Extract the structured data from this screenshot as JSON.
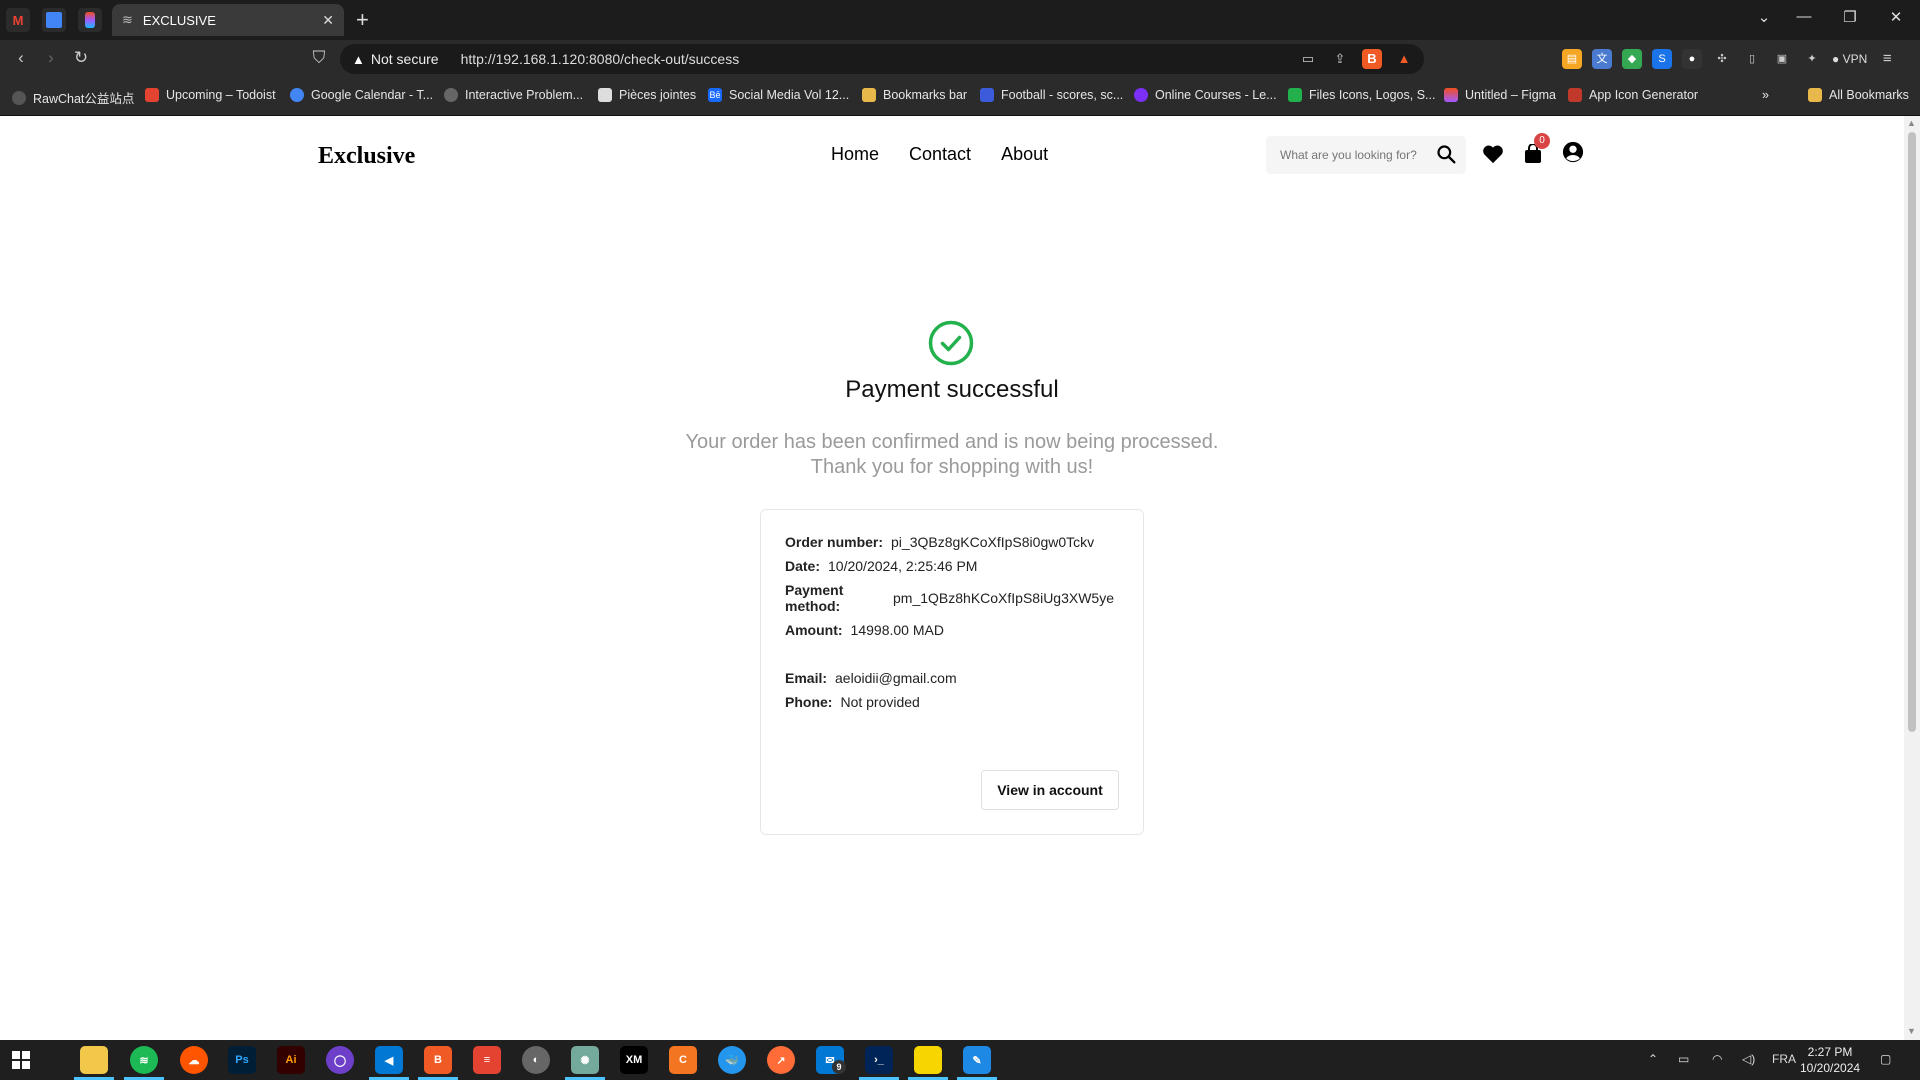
{
  "browser": {
    "tab_title": "EXCLUSIVE",
    "not_secure": "Not secure",
    "url": "http://192.168.1.120:8080/check-out/success",
    "vpn": "VPN",
    "bookmarks": [
      "RawChat公益站点",
      "Upcoming – Todoist",
      "Google Calendar - T...",
      "Interactive Problem...",
      "Pièces jointes",
      "Social Media Vol 12...",
      "Bookmarks bar",
      "Football - scores, sc...",
      "Online Courses - Le...",
      "Files Icons, Logos, S...",
      "Untitled – Figma",
      "App Icon Generator"
    ],
    "all_bookmarks": "All Bookmarks"
  },
  "header": {
    "brand": "Exclusive",
    "nav": [
      "Home",
      "Contact",
      "About"
    ],
    "search_placeholder": "What are you looking for?",
    "cart_count": "0"
  },
  "success": {
    "title": "Payment successful",
    "message_line1": "Your order has been confirmed and is now being processed.",
    "message_line2": "Thank you for shopping with us!"
  },
  "order": {
    "order_number_label": "Order number:",
    "order_number": "pi_3QBz8gKCoXfIpS8i0gw0Tckv",
    "date_label": "Date:",
    "date": "10/20/2024, 2:25:46 PM",
    "payment_method_label": "Payment method:",
    "payment_method": "pm_1QBz8hKCoXfIpS8iUg3XW5ye",
    "amount_label": "Amount:",
    "amount": "14998.00 MAD",
    "email_label": "Email:",
    "email": "aeloidii@gmail.com",
    "phone_label": "Phone:",
    "phone": "Not provided",
    "view_button": "View in account"
  },
  "taskbar": {
    "lang": "FRA",
    "time": "2:27 PM",
    "date": "10/20/2024",
    "badge": "9"
  },
  "colors": {
    "success_green": "#22b14c",
    "badge_red": "#db4444"
  }
}
